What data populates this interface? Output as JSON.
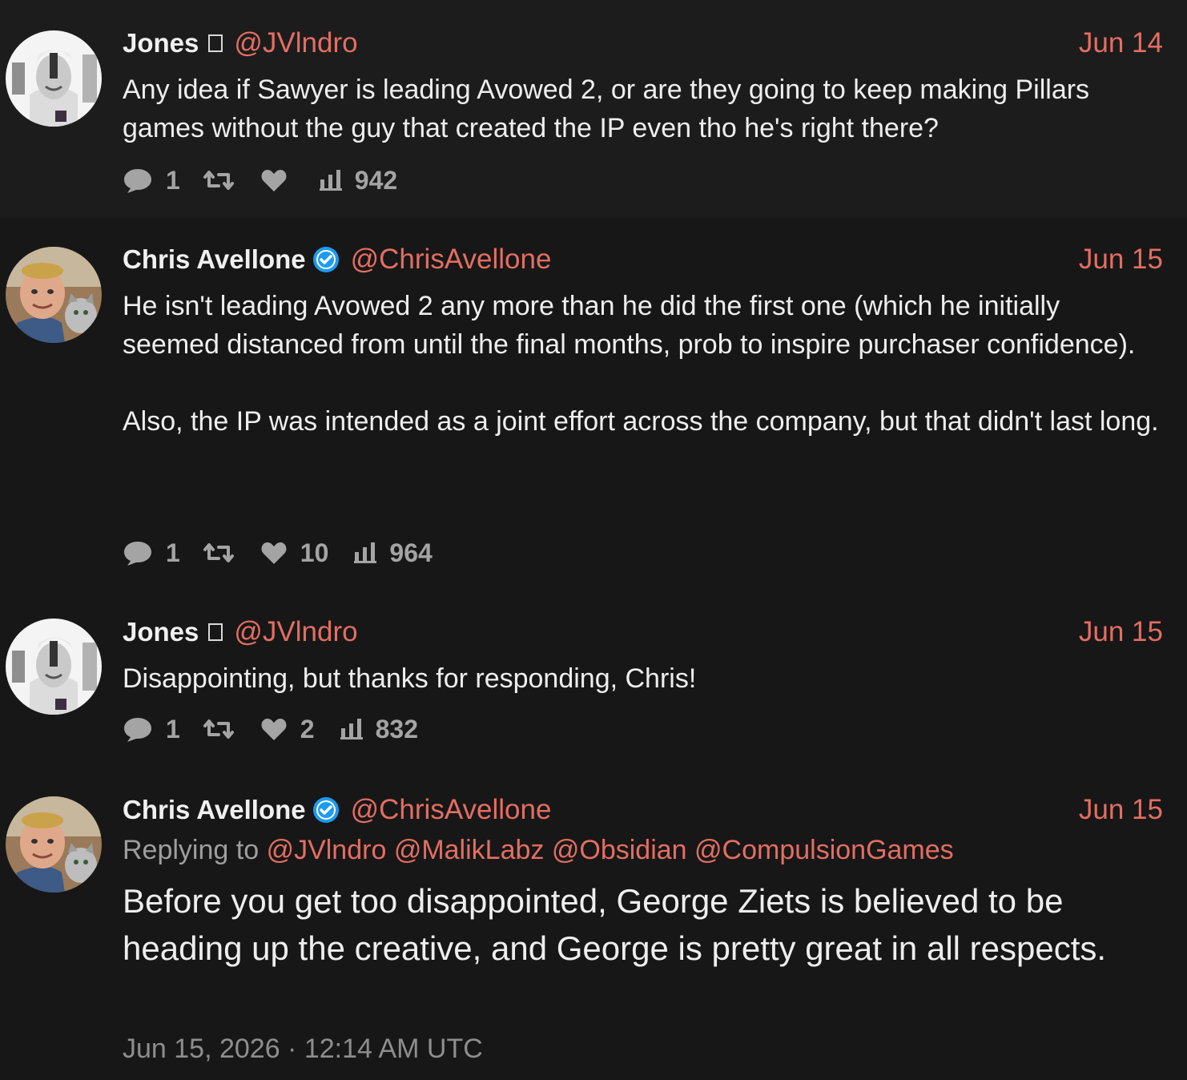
{
  "colors": {
    "background": "#161616",
    "accent": "#e36e62",
    "thread_line": "#a23a35",
    "verified": "#1d9bf0",
    "muted": "#a4a4a4"
  },
  "tweets": [
    {
      "fullname": "Jones",
      "name_glyph": "□",
      "handle": "@JVlndro",
      "date": "Jun 14",
      "text": "Any idea if Sawyer is leading Avowed 2, or are they going to keep making Pillars games without the guy that created the IP even tho he's right there?",
      "stats": {
        "comments": "1",
        "retweets": "",
        "likes": "",
        "views": "942"
      }
    },
    {
      "fullname": "Chris Avellone",
      "verified": true,
      "handle": "@ChrisAvellone",
      "date": "Jun 15",
      "text": "He isn't leading Avowed 2 any more than he did the first one (which he initially seemed distanced from until the final months, prob to inspire purchaser confidence).\n\nAlso, the IP was intended as a joint effort across the company, but that didn't last long.",
      "stats": {
        "comments": "1",
        "retweets": "",
        "likes": "10",
        "views": "964"
      }
    },
    {
      "fullname": "Jones",
      "name_glyph": "□",
      "handle": "@JVlndro",
      "date": "Jun 15",
      "text": "Disappointing, but thanks for responding, Chris!",
      "stats": {
        "comments": "1",
        "retweets": "",
        "likes": "2",
        "views": "832"
      }
    },
    {
      "fullname": "Chris Avellone",
      "verified": true,
      "handle": "@ChrisAvellone",
      "date": "Jun 15",
      "replying_label": "Replying to",
      "replying_to": [
        "@JVlndro",
        "@MalikLabz",
        "@Obsidian",
        "@CompulsionGames"
      ],
      "text": "Before you get too disappointed, George Ziets is believed to be heading up the creative, and George is pretty great in all respects.",
      "timestamp": "Jun 15, 2026 · 12:14 AM UTC"
    }
  ],
  "icons": {
    "comment": "comment-icon",
    "retweet": "retweet-icon",
    "like": "heart-icon",
    "views": "views-bar-chart-icon",
    "verified": "verified-badge-icon"
  }
}
